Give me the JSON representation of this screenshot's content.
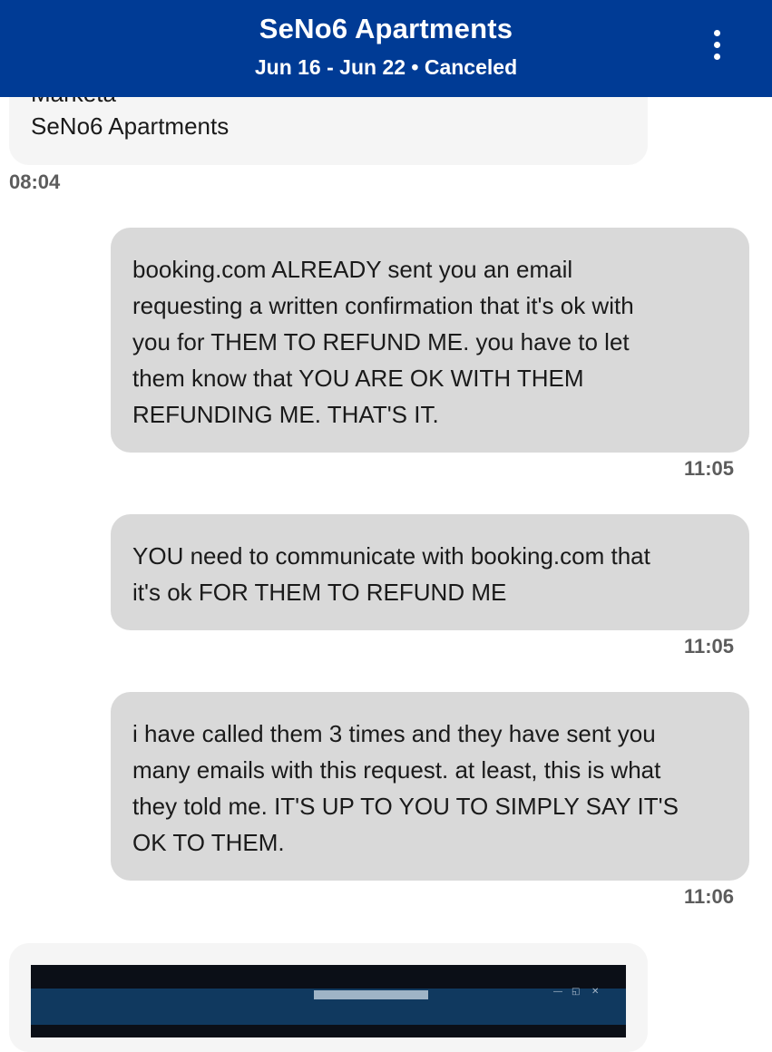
{
  "header": {
    "title": "SeNo6 Apartments",
    "subtitle": "Jun 16 - Jun 22 • Canceled"
  },
  "colors": {
    "header_bg": "#003b95",
    "host_bubble": "#f5f5f5",
    "guest_bubble": "#d9d9d9",
    "timestamp": "#5c5c5c"
  },
  "icons": {
    "menu": "more-vertical-icon"
  },
  "host_message": {
    "cut_off_sender": "Markéta",
    "property": "SeNo6 Apartments",
    "time": "08:04"
  },
  "messages": [
    {
      "lines": [
        "booking.com ALREADY sent you an email",
        "requesting a written confirmation that it's ok with",
        "you for THEM TO REFUND ME. you have to let",
        "them know that YOU ARE OK WITH THEM",
        "REFUNDING ME. THAT'S IT."
      ],
      "time": "11:05"
    },
    {
      "lines": [
        "YOU need to communicate with booking.com that",
        "it's ok FOR THEM TO REFUND ME"
      ],
      "time": "11:05"
    },
    {
      "lines": [
        "i have called them 3 times and they have sent you",
        "many emails with this request. at least, this is what",
        "they told me. IT'S UP TO YOU TO SIMPLY SAY IT'S",
        "OK TO THEM."
      ],
      "time": "11:06"
    }
  ]
}
